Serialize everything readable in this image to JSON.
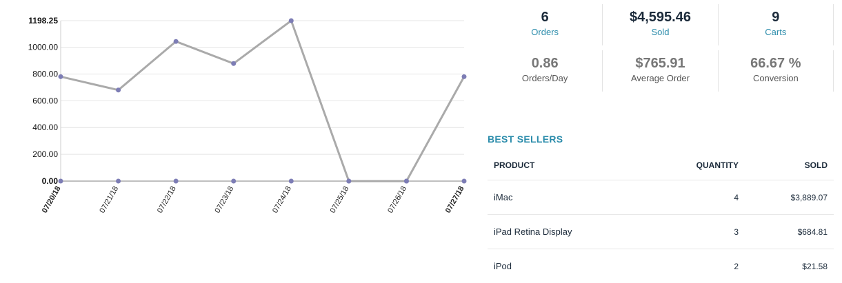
{
  "stats": {
    "orders": {
      "value": "6",
      "label": "Orders"
    },
    "sold": {
      "value": "$4,595.46",
      "label": "Sold"
    },
    "carts": {
      "value": "9",
      "label": "Carts"
    },
    "orders_per_day": {
      "value": "0.86",
      "label": "Orders/Day"
    },
    "average_order": {
      "value": "$765.91",
      "label": "Average Order"
    },
    "conversion": {
      "value": "66.67 %",
      "label": "Conversion"
    }
  },
  "best_sellers": {
    "title": "BEST SELLERS",
    "headers": {
      "product": "PRODUCT",
      "quantity": "QUANTITY",
      "sold": "SOLD"
    },
    "rows": [
      {
        "product": "iMac",
        "quantity": "4",
        "sold": "$3,889.07"
      },
      {
        "product": "iPad Retina Display",
        "quantity": "3",
        "sold": "$684.81"
      },
      {
        "product": "iPod",
        "quantity": "2",
        "sold": "$21.58"
      }
    ]
  },
  "colors": {
    "accent": "#2b8cab",
    "line": "#aaaaaa",
    "point": "#7d7db5"
  },
  "chart_data": {
    "type": "line",
    "categories": [
      "07/20/18",
      "07/21/18",
      "07/22/18",
      "07/23/18",
      "07/24/18",
      "07/25/18",
      "07/26/18",
      "07/27/18"
    ],
    "series": [
      {
        "values": [
          780,
          680,
          1043,
          878,
          1198.25,
          0,
          0,
          780
        ]
      },
      {
        "values": [
          0,
          0,
          0,
          0,
          0,
          0,
          0,
          0
        ]
      }
    ],
    "yticks": [
      "0.00",
      "200.00",
      "400.00",
      "600.00",
      "800.00",
      "1000.00",
      "1198.25"
    ],
    "ylim": [
      0,
      1198.25
    ],
    "grid": true,
    "legend": "none"
  }
}
